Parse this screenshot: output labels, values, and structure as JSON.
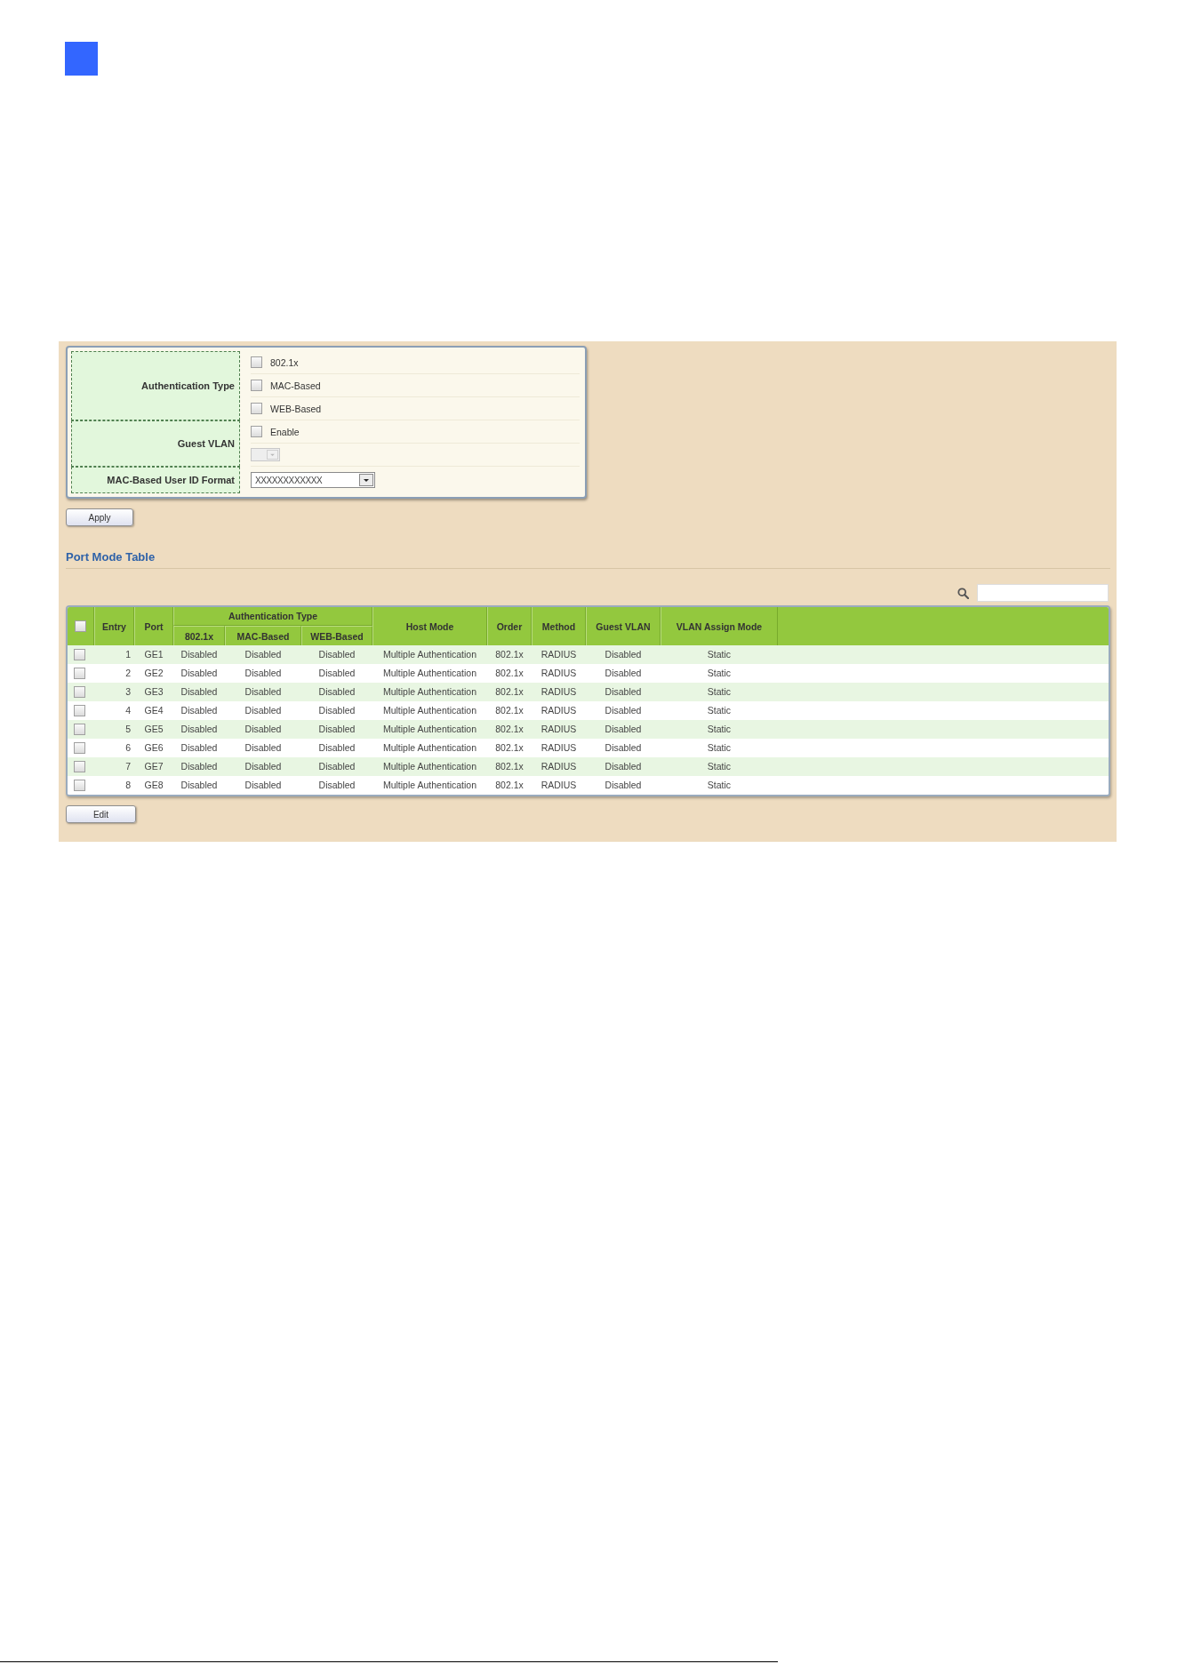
{
  "settings_form": {
    "rows": [
      {
        "label": "Authentication Type",
        "controls": [
          {
            "kind": "checkbox",
            "label": "802.1x",
            "checked": false
          },
          {
            "kind": "checkbox",
            "label": "MAC-Based",
            "checked": false
          },
          {
            "kind": "checkbox",
            "label": "WEB-Based",
            "checked": false
          }
        ]
      },
      {
        "label": "Guest VLAN",
        "controls": [
          {
            "kind": "checkbox",
            "label": "Enable",
            "checked": false
          },
          {
            "kind": "select",
            "disabled": true
          }
        ]
      },
      {
        "label": "MAC-Based User ID Format",
        "controls": [
          {
            "kind": "select",
            "value": "XXXXXXXXXXXX",
            "disabled": false
          }
        ]
      }
    ]
  },
  "apply_button": "Apply",
  "port_mode_table": {
    "title": "Port Mode Table",
    "select_all_checked": false,
    "columns": [
      {
        "label": "Entry"
      },
      {
        "label": "Port"
      },
      {
        "label": "Authentication Type",
        "colspan": 3,
        "children": [
          {
            "label": "802.1x"
          },
          {
            "label": "MAC-Based"
          },
          {
            "label": "WEB-Based"
          }
        ]
      },
      {
        "label": "Host Mode"
      },
      {
        "label": "Order"
      },
      {
        "label": "Method"
      },
      {
        "label": "Guest VLAN"
      },
      {
        "label": "VLAN Assign Mode"
      }
    ],
    "rows": [
      {
        "checked": false,
        "cells": [
          "1",
          "GE1",
          "Disabled",
          "Disabled",
          "Disabled",
          "Multiple Authentication",
          "802.1x",
          "RADIUS",
          "Disabled",
          "Static"
        ]
      },
      {
        "checked": false,
        "cells": [
          "2",
          "GE2",
          "Disabled",
          "Disabled",
          "Disabled",
          "Multiple Authentication",
          "802.1x",
          "RADIUS",
          "Disabled",
          "Static"
        ]
      },
      {
        "checked": false,
        "cells": [
          "3",
          "GE3",
          "Disabled",
          "Disabled",
          "Disabled",
          "Multiple Authentication",
          "802.1x",
          "RADIUS",
          "Disabled",
          "Static"
        ]
      },
      {
        "checked": false,
        "cells": [
          "4",
          "GE4",
          "Disabled",
          "Disabled",
          "Disabled",
          "Multiple Authentication",
          "802.1x",
          "RADIUS",
          "Disabled",
          "Static"
        ]
      },
      {
        "checked": false,
        "cells": [
          "5",
          "GE5",
          "Disabled",
          "Disabled",
          "Disabled",
          "Multiple Authentication",
          "802.1x",
          "RADIUS",
          "Disabled",
          "Static"
        ]
      },
      {
        "checked": false,
        "cells": [
          "6",
          "GE6",
          "Disabled",
          "Disabled",
          "Disabled",
          "Multiple Authentication",
          "802.1x",
          "RADIUS",
          "Disabled",
          "Static"
        ]
      },
      {
        "checked": false,
        "cells": [
          "7",
          "GE7",
          "Disabled",
          "Disabled",
          "Disabled",
          "Multiple Authentication",
          "802.1x",
          "RADIUS",
          "Disabled",
          "Static"
        ]
      },
      {
        "checked": false,
        "cells": [
          "8",
          "GE8",
          "Disabled",
          "Disabled",
          "Disabled",
          "Multiple Authentication",
          "802.1x",
          "RADIUS",
          "Disabled",
          "Static"
        ]
      }
    ],
    "edit_button": "Edit"
  }
}
